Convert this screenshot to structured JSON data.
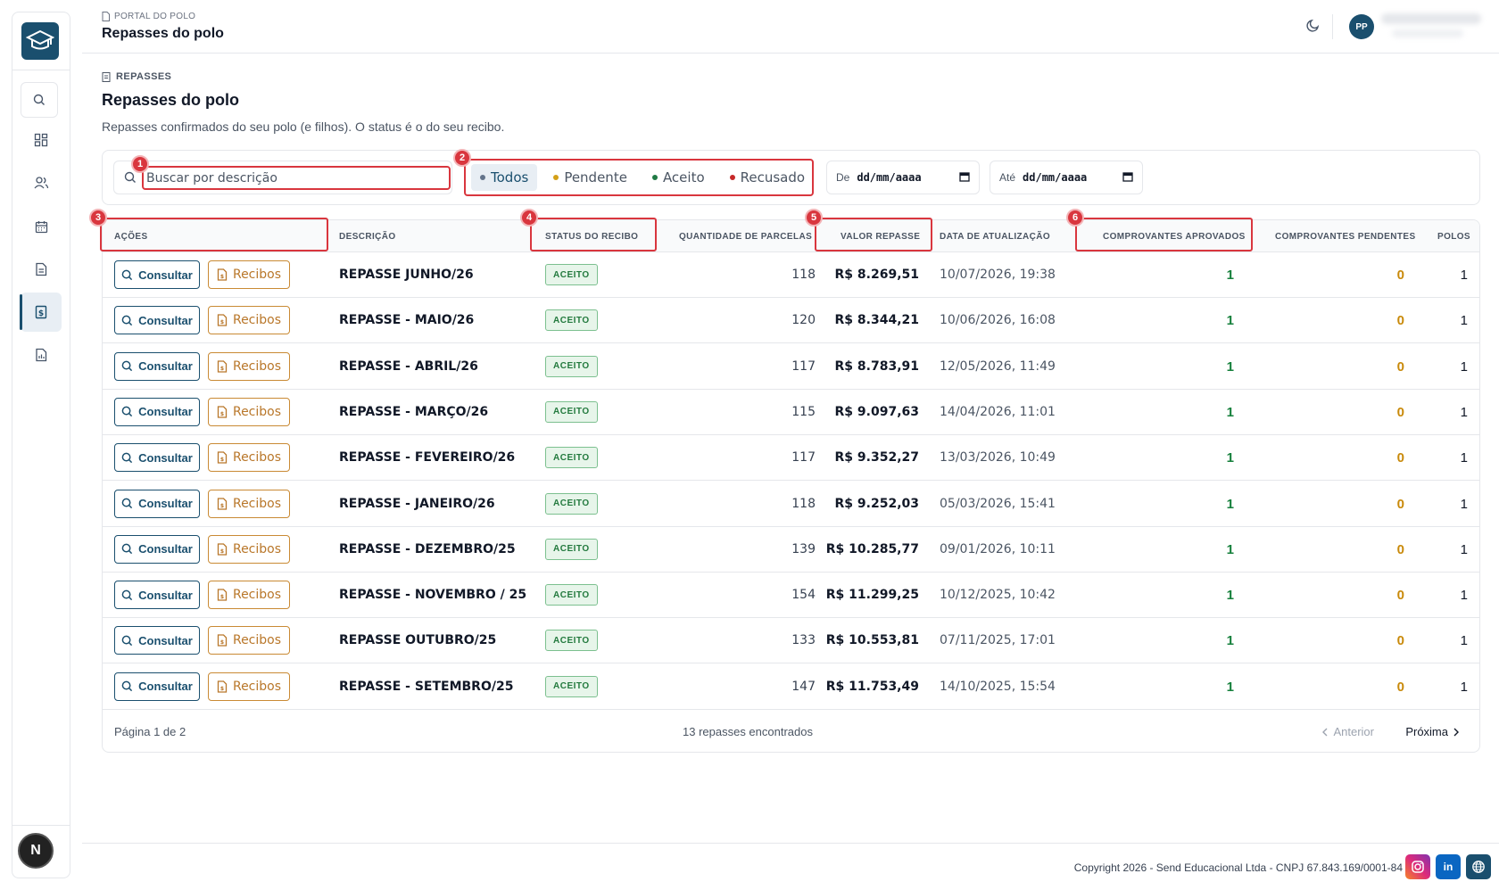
{
  "header": {
    "breadcrumb": "PORTAL DO POLO",
    "title": "Repasses do polo",
    "avatar_initials": "PP"
  },
  "section": {
    "breadcrumb": "REPASSES",
    "title": "Repasses do polo",
    "description": "Repasses confirmados do seu polo (e filhos). O status é o do seu recibo."
  },
  "filters": {
    "search_placeholder": "Buscar por descrição",
    "status_options": [
      {
        "label": "Todos",
        "color": "#64748b"
      },
      {
        "label": "Pendente",
        "color": "#d4a017"
      },
      {
        "label": "Aceito",
        "color": "#1f7a44"
      },
      {
        "label": "Recusado",
        "color": "#c62828"
      }
    ],
    "date_from_label": "De",
    "date_to_label": "Até",
    "date_placeholder": "dd/mm/aaaa"
  },
  "table": {
    "columns": [
      "AÇÕES",
      "DESCRIÇÃO",
      "STATUS DO RECIBO",
      "QUANTIDADE DE PARCELAS",
      "VALOR REPASSE",
      "DATA DE ATUALIZAÇÃO",
      "COMPROVANTES APROVADOS",
      "COMPROVANTES PENDENTES",
      "POLOS"
    ],
    "consultar_label": "Consultar",
    "recibos_label": "Recibos",
    "rows": [
      {
        "descricao": "REPASSE JUNHO/26",
        "status": "ACEITO",
        "parcelas": "118",
        "valor": "R$ 8.269,51",
        "data": "10/07/2026, 19:38",
        "aprovados": "1",
        "pendentes": "0",
        "polos": "1"
      },
      {
        "descricao": "REPASSE - MAIO/26",
        "status": "ACEITO",
        "parcelas": "120",
        "valor": "R$ 8.344,21",
        "data": "10/06/2026, 16:08",
        "aprovados": "1",
        "pendentes": "0",
        "polos": "1"
      },
      {
        "descricao": "REPASSE - ABRIL/26",
        "status": "ACEITO",
        "parcelas": "117",
        "valor": "R$ 8.783,91",
        "data": "12/05/2026, 11:49",
        "aprovados": "1",
        "pendentes": "0",
        "polos": "1"
      },
      {
        "descricao": "REPASSE - MARÇO/26",
        "status": "ACEITO",
        "parcelas": "115",
        "valor": "R$ 9.097,63",
        "data": "14/04/2026, 11:01",
        "aprovados": "1",
        "pendentes": "0",
        "polos": "1"
      },
      {
        "descricao": "REPASSE - FEVEREIRO/26",
        "status": "ACEITO",
        "parcelas": "117",
        "valor": "R$ 9.352,27",
        "data": "13/03/2026, 10:49",
        "aprovados": "1",
        "pendentes": "0",
        "polos": "1"
      },
      {
        "descricao": "REPASSE - JANEIRO/26",
        "status": "ACEITO",
        "parcelas": "118",
        "valor": "R$ 9.252,03",
        "data": "05/03/2026, 15:41",
        "aprovados": "1",
        "pendentes": "0",
        "polos": "1"
      },
      {
        "descricao": "REPASSE - DEZEMBRO/25",
        "status": "ACEITO",
        "parcelas": "139",
        "valor": "R$ 10.285,77",
        "data": "09/01/2026, 10:11",
        "aprovados": "1",
        "pendentes": "0",
        "polos": "1"
      },
      {
        "descricao": "REPASSE - NOVEMBRO / 25",
        "status": "ACEITO",
        "parcelas": "154",
        "valor": "R$ 11.299,25",
        "data": "10/12/2025, 10:42",
        "aprovados": "1",
        "pendentes": "0",
        "polos": "1"
      },
      {
        "descricao": "REPASSE OUTUBRO/25",
        "status": "ACEITO",
        "parcelas": "133",
        "valor": "R$ 10.553,81",
        "data": "07/11/2025, 17:01",
        "aprovados": "1",
        "pendentes": "0",
        "polos": "1"
      },
      {
        "descricao": "REPASSE - SETEMBRO/25",
        "status": "ACEITO",
        "parcelas": "147",
        "valor": "R$ 11.753,49",
        "data": "14/10/2025, 15:54",
        "aprovados": "1",
        "pendentes": "0",
        "polos": "1"
      }
    ]
  },
  "pagination": {
    "page_info": "Página 1 de 2",
    "total": "13 repasses encontrados",
    "prev_label": "Anterior",
    "next_label": "Próxima"
  },
  "annotations": [
    "1",
    "2",
    "3",
    "4",
    "5",
    "6"
  ],
  "footer": {
    "copyright": "Copyright 2026 - Send Educacional Ltda - CNPJ 67.843.169/0001-84",
    "social": [
      {
        "name": "instagram-icon",
        "label": "◎",
        "color": "#d62976"
      },
      {
        "name": "linkedin-icon",
        "label": "in",
        "color": "#0a66c2"
      },
      {
        "name": "globe-icon",
        "label": "",
        "color": "#1a4f6e"
      }
    ]
  },
  "sidebar": {
    "avatar_letter": "N"
  },
  "colors": {
    "brand": "#1a4f6e",
    "annotation": "#d9363e"
  }
}
